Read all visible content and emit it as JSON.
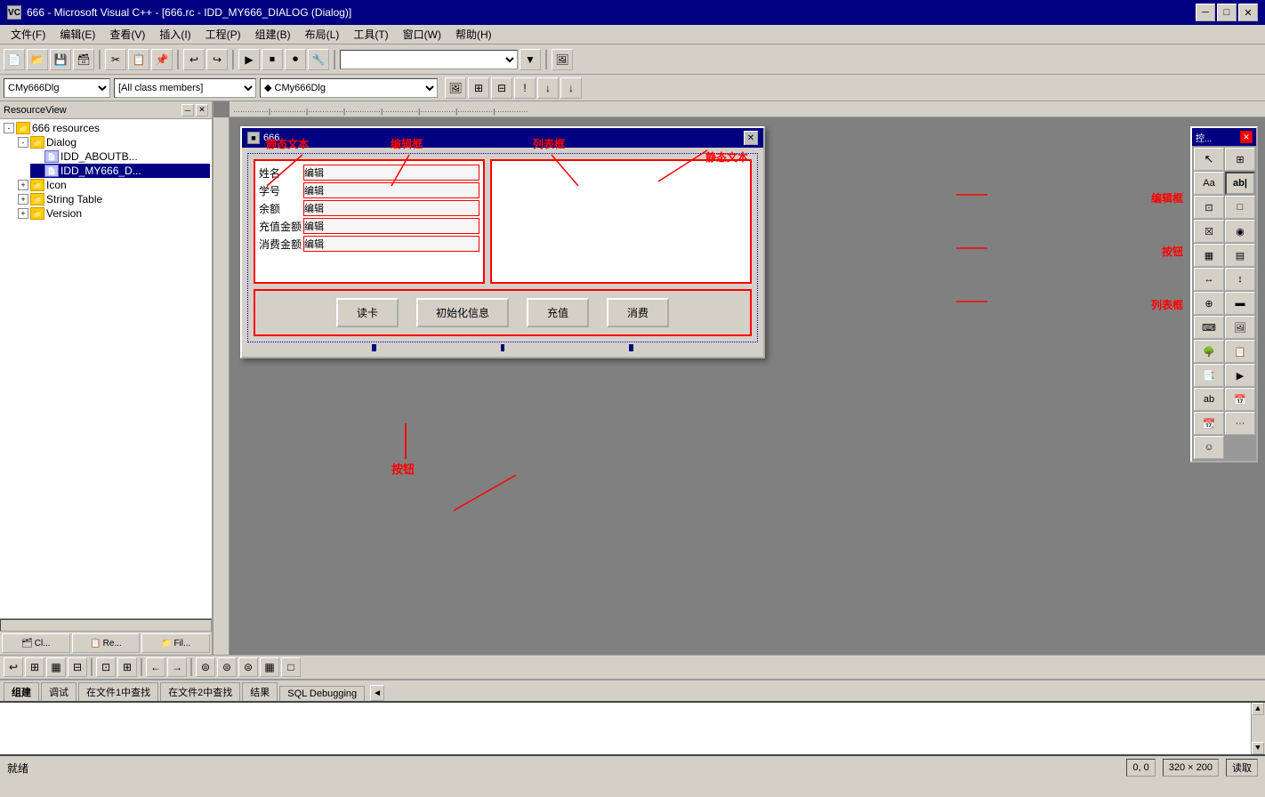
{
  "titleBar": {
    "title": "666 - Microsoft Visual C++ - [666.rc - IDD_MY666_DIALOG (Dialog)]",
    "icon": "VC",
    "minimizeLabel": "─",
    "maximizeLabel": "□",
    "closeLabel": "✕",
    "innerMin": "🗕",
    "innerMax": "🗗",
    "innerClose": "✕"
  },
  "menuBar": {
    "items": [
      {
        "label": "文件(F)"
      },
      {
        "label": "编辑(E)"
      },
      {
        "label": "查看(V)"
      },
      {
        "label": "插入(I)"
      },
      {
        "label": "工程(P)"
      },
      {
        "label": "组建(B)"
      },
      {
        "label": "布局(L)"
      },
      {
        "label": "工具(T)"
      },
      {
        "label": "窗口(W)"
      },
      {
        "label": "帮助(H)"
      }
    ]
  },
  "classToolbar": {
    "classCombo": "CMy666Dlg",
    "membersCombo": "[All class members]",
    "methodCombo": "◆ CMy666Dlg"
  },
  "sidebar": {
    "title": "ResourceView",
    "treeItems": [
      {
        "id": "root",
        "label": "666 resources",
        "indent": 0,
        "expanded": true,
        "type": "folder"
      },
      {
        "id": "dialog",
        "label": "Dialog",
        "indent": 1,
        "expanded": true,
        "type": "folder"
      },
      {
        "id": "aboutbox",
        "label": "IDD_ABOUTB...",
        "indent": 2,
        "type": "file"
      },
      {
        "id": "my666",
        "label": "IDD_MY666_D...",
        "indent": 2,
        "type": "file",
        "selected": true
      },
      {
        "id": "icon",
        "label": "Icon",
        "indent": 1,
        "expanded": false,
        "type": "folder"
      },
      {
        "id": "stringtable",
        "label": "String Table",
        "indent": 1,
        "expanded": false,
        "type": "folder"
      },
      {
        "id": "version",
        "label": "Version",
        "indent": 1,
        "expanded": false,
        "type": "folder"
      }
    ],
    "tabs": [
      {
        "label": "Cl...",
        "icon": "🗂"
      },
      {
        "label": "Re...",
        "icon": "📋"
      },
      {
        "label": "Fil...",
        "icon": "📁"
      }
    ]
  },
  "dialog": {
    "title": "666",
    "closeBtn": "✕",
    "labels": [
      "姓名",
      "学号",
      "余额",
      "充值金额",
      "消费金额"
    ],
    "editPlaceholders": [
      "编辑",
      "编辑",
      "编辑",
      "编辑",
      "编辑"
    ],
    "buttons": [
      "读卡",
      "初始化信息",
      "充值",
      "消费"
    ],
    "annotations": {
      "staticText1": "静态文本",
      "editBox": "编辑框",
      "listBox": "列表框",
      "staticText2": "静态文本",
      "editBoxRight": "编辑框",
      "buttonLabel": "按钮",
      "buttonAnnotation": "按钮",
      "listBoxRight": "列表框"
    }
  },
  "controlsPanel": {
    "title": "控...",
    "closeBtn": "✕",
    "controls": [
      {
        "icon": "▶",
        "name": "pointer"
      },
      {
        "icon": "⊞",
        "name": "select"
      },
      {
        "icon": "Aa",
        "name": "static-text"
      },
      {
        "icon": "ab|",
        "name": "edit-box"
      },
      {
        "icon": "⊡",
        "name": "group-box"
      },
      {
        "icon": "□",
        "name": "push-button"
      },
      {
        "icon": "☒",
        "name": "check-box"
      },
      {
        "icon": "◉",
        "name": "radio-button"
      },
      {
        "icon": "▦",
        "name": "combo-box"
      },
      {
        "icon": "▤",
        "name": "list-box"
      },
      {
        "icon": "⊞",
        "name": "horizontal-scroll"
      },
      {
        "icon": "▧",
        "name": "vertical-scroll"
      },
      {
        "icon": "↕",
        "name": "spin"
      },
      {
        "icon": "▓",
        "name": "progress"
      },
      {
        "icon": "🔑",
        "name": "hotkey"
      },
      {
        "icon": "◫",
        "name": "image"
      },
      {
        "icon": "▦",
        "name": "tree-ctrl"
      },
      {
        "icon": "▤",
        "name": "list-ctrl"
      },
      {
        "icon": "📁",
        "name": "tab-ctrl"
      },
      {
        "icon": "▣",
        "name": "animate"
      },
      {
        "icon": "ab",
        "name": "rich-edit"
      },
      {
        "icon": "◪",
        "name": "date-time"
      },
      {
        "icon": "▦",
        "name": "month-cal"
      },
      {
        "icon": "...",
        "name": "ip-addr"
      },
      {
        "icon": "☻",
        "name": "custom"
      }
    ]
  },
  "bottomTabs": [
    "组建",
    "调试",
    "在文件1中查找",
    "在文件2中查找",
    "结果",
    "SQL Debugging"
  ],
  "statusBar": {
    "left": "就绪",
    "coords": "0, 0",
    "size": "320 × 200",
    "mode": "读取"
  },
  "outputArea": "",
  "colors": {
    "titleBg": "#000080",
    "menuBg": "#d4d0c8",
    "red": "#ff0000",
    "dialogBg": "#d4d0c8",
    "designerBg": "#808080"
  }
}
